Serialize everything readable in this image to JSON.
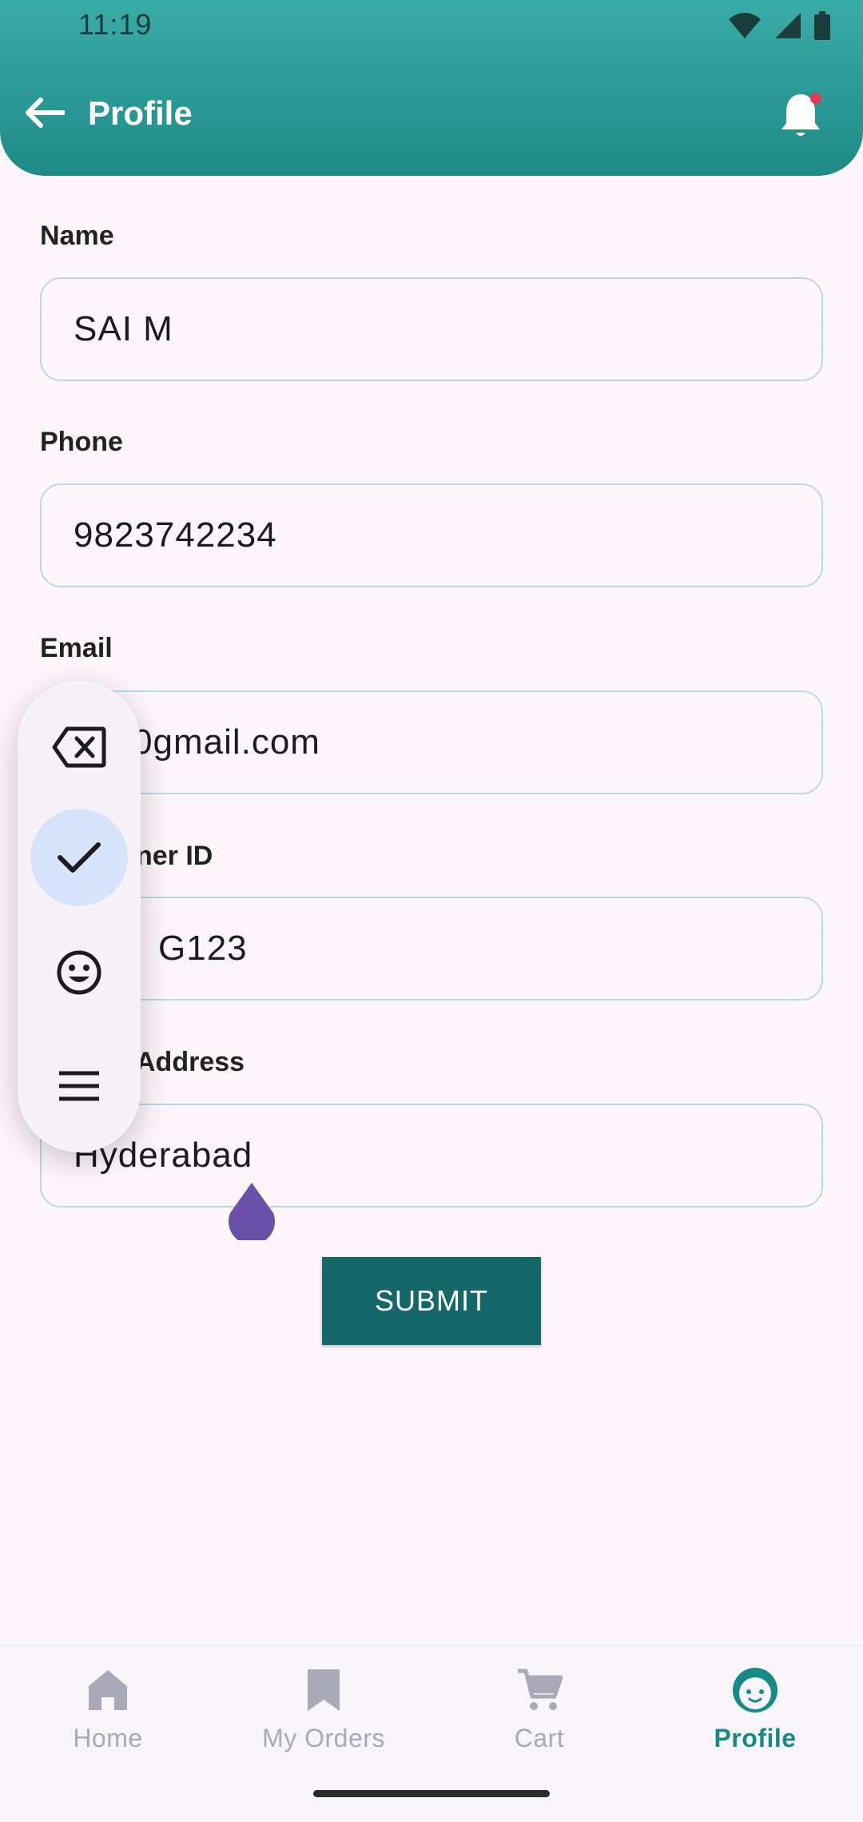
{
  "status_bar": {
    "time": "11:19"
  },
  "header": {
    "title": "Profile"
  },
  "form": {
    "name": {
      "label": "Name",
      "value": "SAI M"
    },
    "phone": {
      "label": "Phone",
      "value": "9823742234"
    },
    "email": {
      "label": "Email",
      "value": "0gmail.com"
    },
    "customer_id": {
      "label": "ner ID",
      "value": "G123"
    },
    "address": {
      "label": "Address",
      "value": "Hyderabad"
    },
    "submit_label": "SUBMIT"
  },
  "keyboard_toolbar": {
    "icons": [
      "backspace-icon",
      "check-icon",
      "emoji-icon",
      "menu-icon"
    ]
  },
  "bottom_nav": {
    "items": [
      {
        "label": "Home",
        "icon": "home-icon"
      },
      {
        "label": "My Orders",
        "icon": "bookmark-icon"
      },
      {
        "label": "Cart",
        "icon": "cart-icon"
      },
      {
        "label": "Profile",
        "icon": "profile-face-icon"
      }
    ],
    "active_index": 3
  },
  "colors": {
    "header_top": "#3aaca8",
    "header_bottom": "#1e8a86",
    "submit": "#146869",
    "nav_active": "#168a86",
    "nav_inactive": "#a9a9b8",
    "cursor_handle": "#6a4fa8"
  }
}
